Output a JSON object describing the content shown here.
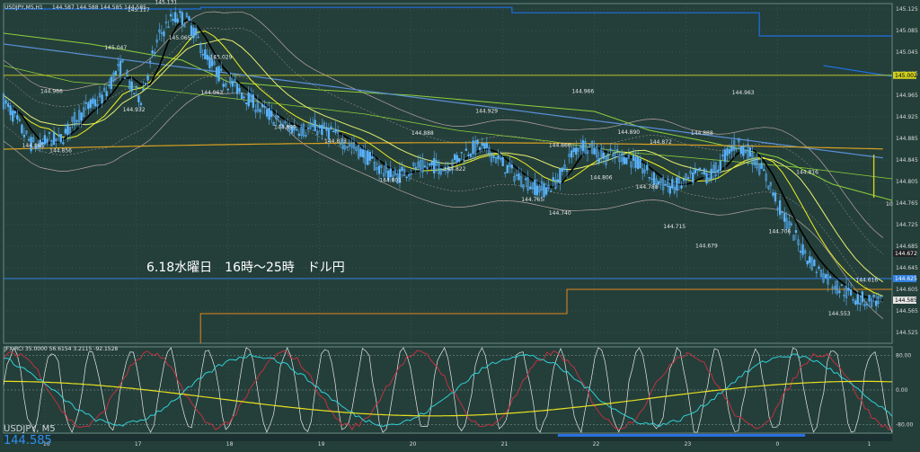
{
  "window": {
    "title": "USDJPY,M5,H1",
    "ohlc": "144.587 144.588 144.585 144.585",
    "symbol_footer": "USDJPY, M5",
    "bid_footer": "144.585"
  },
  "annotation": {
    "caption": "6.18水曜日　16時～25時　ドル円",
    "marker": "10"
  },
  "colors": {
    "background": "#243f3a",
    "grid": "#4a6a64",
    "candle": "#5ab4ff",
    "ma_black": "#000000",
    "ma_yellow": "#f0f020",
    "ma_lightyellow": "#e8f070",
    "ma_green": "#8fcf3a",
    "ma_blue": "#5a8fd8",
    "ma_orange": "#d9a020",
    "bb_band": "#b9a3a0",
    "step_blue": "#1e6fe0",
    "step_orange": "#e08a1e",
    "hline_yellow": "#d0d020",
    "hline_blue": "#3080e0",
    "rci_white": "#e8e8e8",
    "rci_red": "#c03040",
    "rci_cyan": "#30d0d8",
    "rci_yellow": "#e8e020"
  },
  "chart_data": [
    {
      "type": "candlestick",
      "title": "USDJPY,M5,H1",
      "y_axis": {
        "ticks": [
          "145.125",
          "145.085",
          "145.045",
          "145.005",
          "144.965",
          "144.925",
          "144.885",
          "144.845",
          "144.805",
          "144.765",
          "144.725",
          "144.685",
          "144.645",
          "144.605",
          "144.565",
          "144.525"
        ],
        "ylim": [
          144.505,
          145.135
        ]
      },
      "x_axis": {
        "ticks": [
          "16",
          "17",
          "18",
          "19",
          "20",
          "21",
          "22",
          "23",
          "0",
          "1"
        ]
      },
      "price_labels": [
        {
          "text": "145.131",
          "x_hour": 17.3,
          "y": 145.131
        },
        {
          "text": "145.117",
          "x_hour": 17.0,
          "y": 145.117
        },
        {
          "text": "145.047",
          "x_hour": 16.75,
          "y": 145.047
        },
        {
          "text": "145.065",
          "x_hour": 17.45,
          "y": 145.065
        },
        {
          "text": "145.029",
          "x_hour": 17.9,
          "y": 145.029
        },
        {
          "text": "144.966",
          "x_hour": 16.05,
          "y": 144.966
        },
        {
          "text": "144.932",
          "x_hour": 16.95,
          "y": 144.932
        },
        {
          "text": "144.963",
          "x_hour": 17.8,
          "y": 144.963
        },
        {
          "text": "144.865",
          "x_hour": 15.85,
          "y": 144.865
        },
        {
          "text": "144.856",
          "x_hour": 16.15,
          "y": 144.856
        },
        {
          "text": "144.899",
          "x_hour": 18.6,
          "y": 144.899
        },
        {
          "text": "144.873",
          "x_hour": 19.15,
          "y": 144.873
        },
        {
          "text": "144.801",
          "x_hour": 19.75,
          "y": 144.801
        },
        {
          "text": "144.888",
          "x_hour": 20.1,
          "y": 144.888
        },
        {
          "text": "144.822",
          "x_hour": 20.45,
          "y": 144.822
        },
        {
          "text": "144.929",
          "x_hour": 20.8,
          "y": 144.929
        },
        {
          "text": "144.966",
          "x_hour": 21.85,
          "y": 144.966
        },
        {
          "text": "144.866",
          "x_hour": 21.6,
          "y": 144.866
        },
        {
          "text": "144.765",
          "x_hour": 21.3,
          "y": 144.765
        },
        {
          "text": "144.740",
          "x_hour": 21.6,
          "y": 144.74
        },
        {
          "text": "144.806",
          "x_hour": 22.05,
          "y": 144.806
        },
        {
          "text": "144.890",
          "x_hour": 22.35,
          "y": 144.89
        },
        {
          "text": "144.788",
          "x_hour": 22.55,
          "y": 144.788
        },
        {
          "text": "144.872",
          "x_hour": 22.7,
          "y": 144.872
        },
        {
          "text": "144.715",
          "x_hour": 22.85,
          "y": 144.715
        },
        {
          "text": "144.888",
          "x_hour": 23.15,
          "y": 144.888
        },
        {
          "text": "144.679",
          "x_hour": 23.2,
          "y": 144.679
        },
        {
          "text": "144.963",
          "x_hour": 23.6,
          "y": 144.963
        },
        {
          "text": "144.816",
          "x_hour": 24.3,
          "y": 144.816
        },
        {
          "text": "144.706",
          "x_hour": 24.0,
          "y": 144.706
        },
        {
          "text": "144.616",
          "x_hour": 24.95,
          "y": 144.616
        },
        {
          "text": "144.553",
          "x_hour": 24.65,
          "y": 144.553
        }
      ],
      "right_markers": [
        {
          "text": "145.002",
          "y": 145.002,
          "color": "#d0d020"
        },
        {
          "text": "144.672",
          "y": 144.672,
          "color": "#202020"
        },
        {
          "text": "144.625",
          "y": 144.625,
          "color": "#3080e0"
        },
        {
          "text": "144.585",
          "y": 144.585,
          "color": "#e6e6e6"
        }
      ],
      "horizontal_lines": [
        {
          "y": 145.002,
          "color": "#d0d020"
        },
        {
          "y": 144.625,
          "color": "#3080e0"
        }
      ],
      "close_path": [
        [
          15.55,
          144.955
        ],
        [
          15.65,
          144.93
        ],
        [
          15.75,
          144.9
        ],
        [
          15.85,
          144.875
        ],
        [
          15.95,
          144.87
        ],
        [
          16.05,
          144.885
        ],
        [
          16.15,
          144.88
        ],
        [
          16.25,
          144.9
        ],
        [
          16.35,
          144.925
        ],
        [
          16.45,
          144.94
        ],
        [
          16.55,
          144.95
        ],
        [
          16.65,
          144.965
        ],
        [
          16.75,
          145.0
        ],
        [
          16.85,
          145.02
        ],
        [
          16.95,
          144.975
        ],
        [
          17.05,
          144.96
        ],
        [
          17.15,
          145.02
        ],
        [
          17.25,
          145.075
        ],
        [
          17.35,
          145.1
        ],
        [
          17.45,
          145.11
        ],
        [
          17.55,
          145.105
        ],
        [
          17.65,
          145.075
        ],
        [
          17.75,
          145.04
        ],
        [
          17.85,
          145.015
        ],
        [
          17.95,
          144.995
        ],
        [
          18.05,
          144.985
        ],
        [
          18.15,
          144.97
        ],
        [
          18.25,
          144.955
        ],
        [
          18.35,
          144.94
        ],
        [
          18.45,
          144.93
        ],
        [
          18.55,
          144.915
        ],
        [
          18.65,
          144.905
        ],
        [
          18.75,
          144.905
        ],
        [
          18.85,
          144.9
        ],
        [
          18.95,
          144.905
        ],
        [
          19.05,
          144.9
        ],
        [
          19.15,
          144.895
        ],
        [
          19.25,
          144.88
        ],
        [
          19.35,
          144.87
        ],
        [
          19.45,
          144.86
        ],
        [
          19.55,
          144.845
        ],
        [
          19.65,
          144.83
        ],
        [
          19.75,
          144.82
        ],
        [
          19.85,
          144.815
        ],
        [
          19.95,
          144.825
        ],
        [
          20.05,
          144.83
        ],
        [
          20.15,
          144.83
        ],
        [
          20.25,
          144.835
        ],
        [
          20.35,
          144.83
        ],
        [
          20.45,
          144.84
        ],
        [
          20.55,
          144.855
        ],
        [
          20.65,
          144.865
        ],
        [
          20.75,
          144.87
        ],
        [
          20.85,
          144.86
        ],
        [
          20.95,
          144.845
        ],
        [
          21.05,
          144.83
        ],
        [
          21.15,
          144.815
        ],
        [
          21.25,
          144.805
        ],
        [
          21.35,
          144.795
        ],
        [
          21.45,
          144.79
        ],
        [
          21.55,
          144.8
        ],
        [
          21.65,
          144.82
        ],
        [
          21.75,
          144.855
        ],
        [
          21.85,
          144.875
        ],
        [
          21.95,
          144.87
        ],
        [
          22.05,
          144.855
        ],
        [
          22.15,
          144.85
        ],
        [
          22.25,
          144.855
        ],
        [
          22.35,
          144.85
        ],
        [
          22.45,
          144.84
        ],
        [
          22.55,
          144.825
        ],
        [
          22.65,
          144.81
        ],
        [
          22.75,
          144.8
        ],
        [
          22.85,
          144.795
        ],
        [
          22.95,
          144.8
        ],
        [
          23.05,
          144.81
        ],
        [
          23.15,
          144.82
        ],
        [
          23.25,
          144.815
        ],
        [
          23.35,
          144.83
        ],
        [
          23.45,
          144.86
        ],
        [
          23.55,
          144.875
        ],
        [
          23.65,
          144.865
        ],
        [
          23.75,
          144.845
        ],
        [
          23.85,
          144.82
        ],
        [
          23.95,
          144.785
        ],
        [
          24.05,
          144.745
        ],
        [
          24.15,
          144.715
        ],
        [
          24.25,
          144.685
        ],
        [
          24.35,
          144.66
        ],
        [
          24.45,
          144.64
        ],
        [
          24.55,
          144.625
        ],
        [
          24.65,
          144.61
        ],
        [
          24.75,
          144.6
        ],
        [
          24.85,
          144.59
        ],
        [
          24.95,
          144.585
        ],
        [
          25.05,
          144.585
        ],
        [
          25.15,
          144.585
        ]
      ],
      "indicator": {
        "title": "JFX-RCI 35.0000 56.6154 3.2115 -92.1528",
        "ticks": [
          "80.00",
          "0.00",
          "-80.00"
        ],
        "ylim": [
          -100,
          100
        ]
      }
    }
  ]
}
